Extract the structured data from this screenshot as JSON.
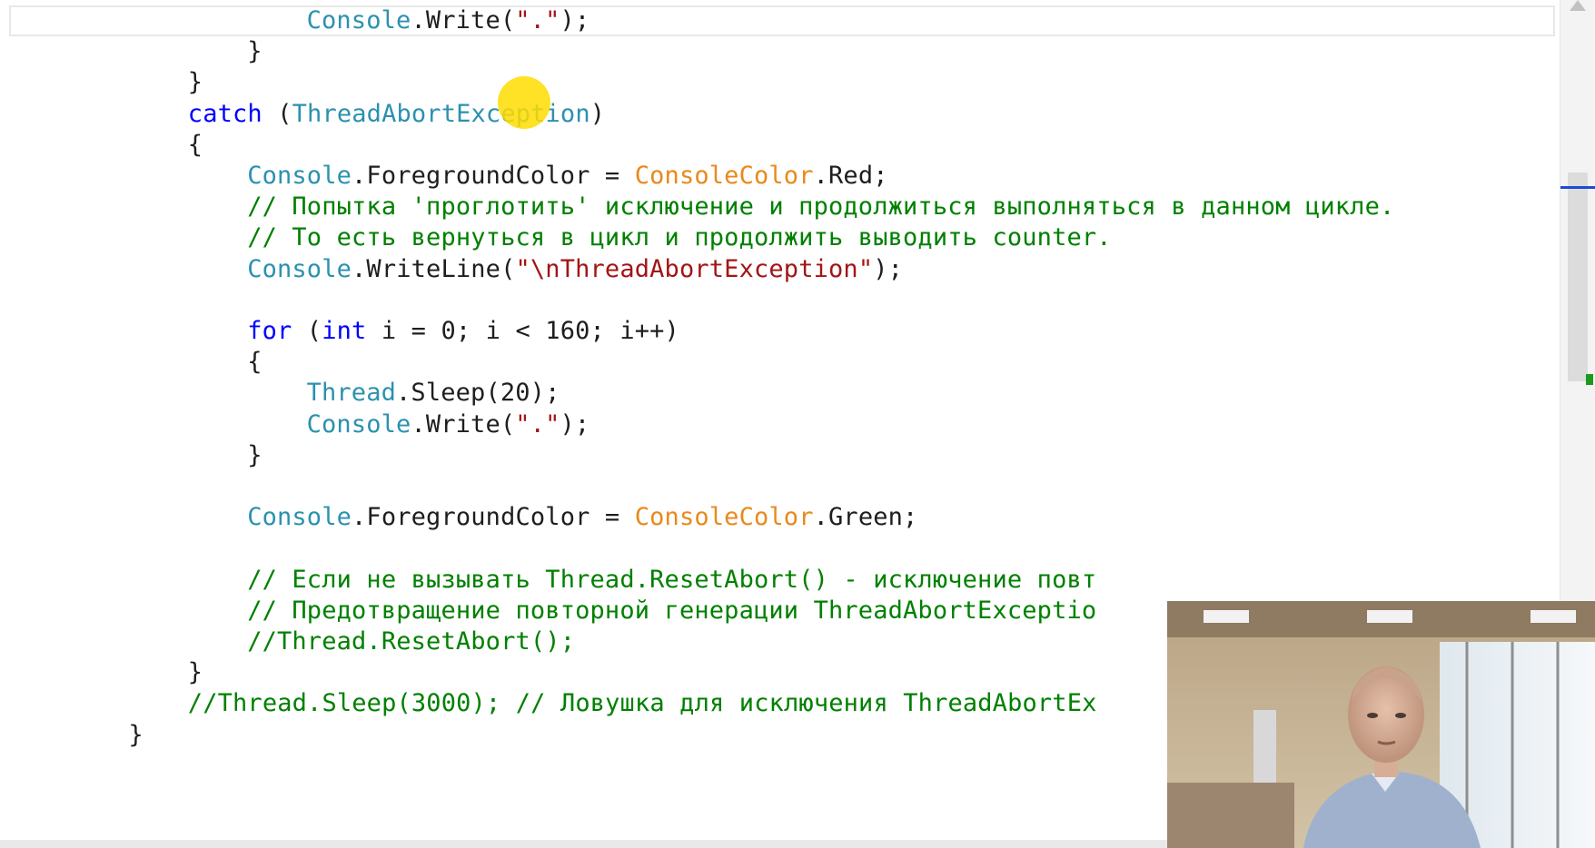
{
  "editor": {
    "lines": [
      {
        "indent": 8,
        "parts": [
          {
            "t": "Console",
            "c": "type"
          },
          {
            "t": ".Write(",
            "c": "plain"
          },
          {
            "t": "\".\"",
            "c": "str"
          },
          {
            "t": ");",
            "c": "plain"
          }
        ]
      },
      {
        "indent": 6,
        "parts": [
          {
            "t": "}",
            "c": "plain"
          }
        ]
      },
      {
        "indent": 4,
        "parts": [
          {
            "t": "}",
            "c": "plain"
          }
        ]
      },
      {
        "indent": 4,
        "parts": [
          {
            "t": "catch",
            "c": "kw"
          },
          {
            "t": " (",
            "c": "plain"
          },
          {
            "t": "ThreadAbortException",
            "c": "type"
          },
          {
            "t": ")",
            "c": "plain"
          }
        ]
      },
      {
        "indent": 4,
        "parts": [
          {
            "t": "{",
            "c": "plain"
          }
        ]
      },
      {
        "indent": 6,
        "parts": [
          {
            "t": "Console",
            "c": "type"
          },
          {
            "t": ".ForegroundColor = ",
            "c": "plain"
          },
          {
            "t": "ConsoleColor",
            "c": "enum"
          },
          {
            "t": ".Red;",
            "c": "plain"
          }
        ]
      },
      {
        "indent": 6,
        "parts": [
          {
            "t": "// Попытка 'проглотить' исключение и продолжиться выполняться в данном цикле.",
            "c": "cmt"
          }
        ]
      },
      {
        "indent": 6,
        "parts": [
          {
            "t": "// То есть вернуться в цикл и продолжить выводить counter.",
            "c": "cmt"
          }
        ]
      },
      {
        "indent": 6,
        "parts": [
          {
            "t": "Console",
            "c": "type"
          },
          {
            "t": ".WriteLine(",
            "c": "plain"
          },
          {
            "t": "\"\\nThreadAbortException\"",
            "c": "str"
          },
          {
            "t": ");",
            "c": "plain"
          }
        ]
      },
      {
        "indent": 0,
        "parts": []
      },
      {
        "indent": 6,
        "parts": [
          {
            "t": "for",
            "c": "kw"
          },
          {
            "t": " (",
            "c": "plain"
          },
          {
            "t": "int",
            "c": "kw"
          },
          {
            "t": " i = 0; i < 160; i++)",
            "c": "plain"
          }
        ]
      },
      {
        "indent": 6,
        "parts": [
          {
            "t": "{",
            "c": "plain"
          }
        ]
      },
      {
        "indent": 8,
        "parts": [
          {
            "t": "Thread",
            "c": "type"
          },
          {
            "t": ".Sleep(20);",
            "c": "plain"
          }
        ]
      },
      {
        "indent": 8,
        "parts": [
          {
            "t": "Console",
            "c": "type"
          },
          {
            "t": ".Write(",
            "c": "plain"
          },
          {
            "t": "\".\"",
            "c": "str"
          },
          {
            "t": ");",
            "c": "plain"
          }
        ]
      },
      {
        "indent": 6,
        "parts": [
          {
            "t": "}",
            "c": "plain"
          }
        ]
      },
      {
        "indent": 0,
        "parts": []
      },
      {
        "indent": 6,
        "parts": [
          {
            "t": "Console",
            "c": "type"
          },
          {
            "t": ".ForegroundColor = ",
            "c": "plain"
          },
          {
            "t": "ConsoleColor",
            "c": "enum"
          },
          {
            "t": ".Green;",
            "c": "plain"
          }
        ]
      },
      {
        "indent": 0,
        "parts": []
      },
      {
        "indent": 6,
        "parts": [
          {
            "t": "// Если не вызывать Thread.ResetAbort() - исключение повт",
            "c": "cmt"
          }
        ]
      },
      {
        "indent": 6,
        "parts": [
          {
            "t": "// Предотвращение повторной генерации ThreadAbortExceptio",
            "c": "cmt"
          }
        ]
      },
      {
        "indent": 6,
        "parts": [
          {
            "t": "//Thread.ResetAbort();",
            "c": "cmt"
          }
        ]
      },
      {
        "indent": 4,
        "parts": [
          {
            "t": "}",
            "c": "plain"
          }
        ]
      },
      {
        "indent": 4,
        "parts": [
          {
            "t": "//Thread.Sleep(3000); // Ловушка для исключения ThreadAbortEx",
            "c": "cmt"
          }
        ]
      },
      {
        "indent": 2,
        "parts": [
          {
            "t": "}",
            "c": "plain"
          }
        ]
      }
    ]
  },
  "colors": {
    "keyword": "#0000ff",
    "type": "#2b91af",
    "enum": "#e8891c",
    "string": "#a31515",
    "comment": "#008000",
    "cursor_highlight": "#ffdc00",
    "scroll_marker_blue": "#1c4bd6",
    "scroll_marker_green": "#1b9a1b"
  },
  "icons": {
    "scroll_up": "scroll-up-arrow-icon",
    "cursor": "cursor-highlight-icon"
  },
  "webcam": {
    "subject": "presenter-webcam-overlay"
  }
}
